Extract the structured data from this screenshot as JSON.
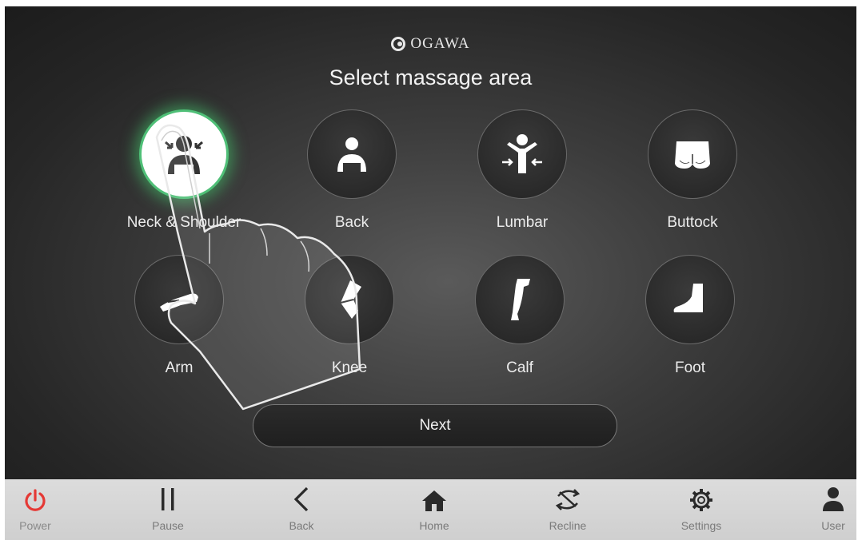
{
  "header": {
    "brand": "OGAWA",
    "title": "Select massage area"
  },
  "areas": [
    {
      "label": "Neck & Shoulder",
      "icon": "neck-shoulder-icon",
      "selected": true
    },
    {
      "label": "Back",
      "icon": "back-icon",
      "selected": false
    },
    {
      "label": "Lumbar",
      "icon": "lumbar-icon",
      "selected": false
    },
    {
      "label": "Buttock",
      "icon": "buttock-icon",
      "selected": false
    },
    {
      "label": "Arm",
      "icon": "arm-icon",
      "selected": false
    },
    {
      "label": "Knee",
      "icon": "knee-icon",
      "selected": false
    },
    {
      "label": "Calf",
      "icon": "calf-icon",
      "selected": false
    },
    {
      "label": "Foot",
      "icon": "foot-icon",
      "selected": false
    }
  ],
  "next_label": "Next",
  "nav": [
    {
      "label": "Power",
      "icon": "power-icon"
    },
    {
      "label": "Pause",
      "icon": "pause-icon"
    },
    {
      "label": "Back",
      "icon": "chevron-left-icon"
    },
    {
      "label": "Home",
      "icon": "home-icon"
    },
    {
      "label": "Recline",
      "icon": "recline-icon"
    },
    {
      "label": "Settings",
      "icon": "gear-icon"
    },
    {
      "label": "User",
      "icon": "user-icon"
    }
  ],
  "colors": {
    "selected_glow": "#4fbf77",
    "power_red": "#e53935",
    "nav_icon": "#2a2a2a"
  }
}
